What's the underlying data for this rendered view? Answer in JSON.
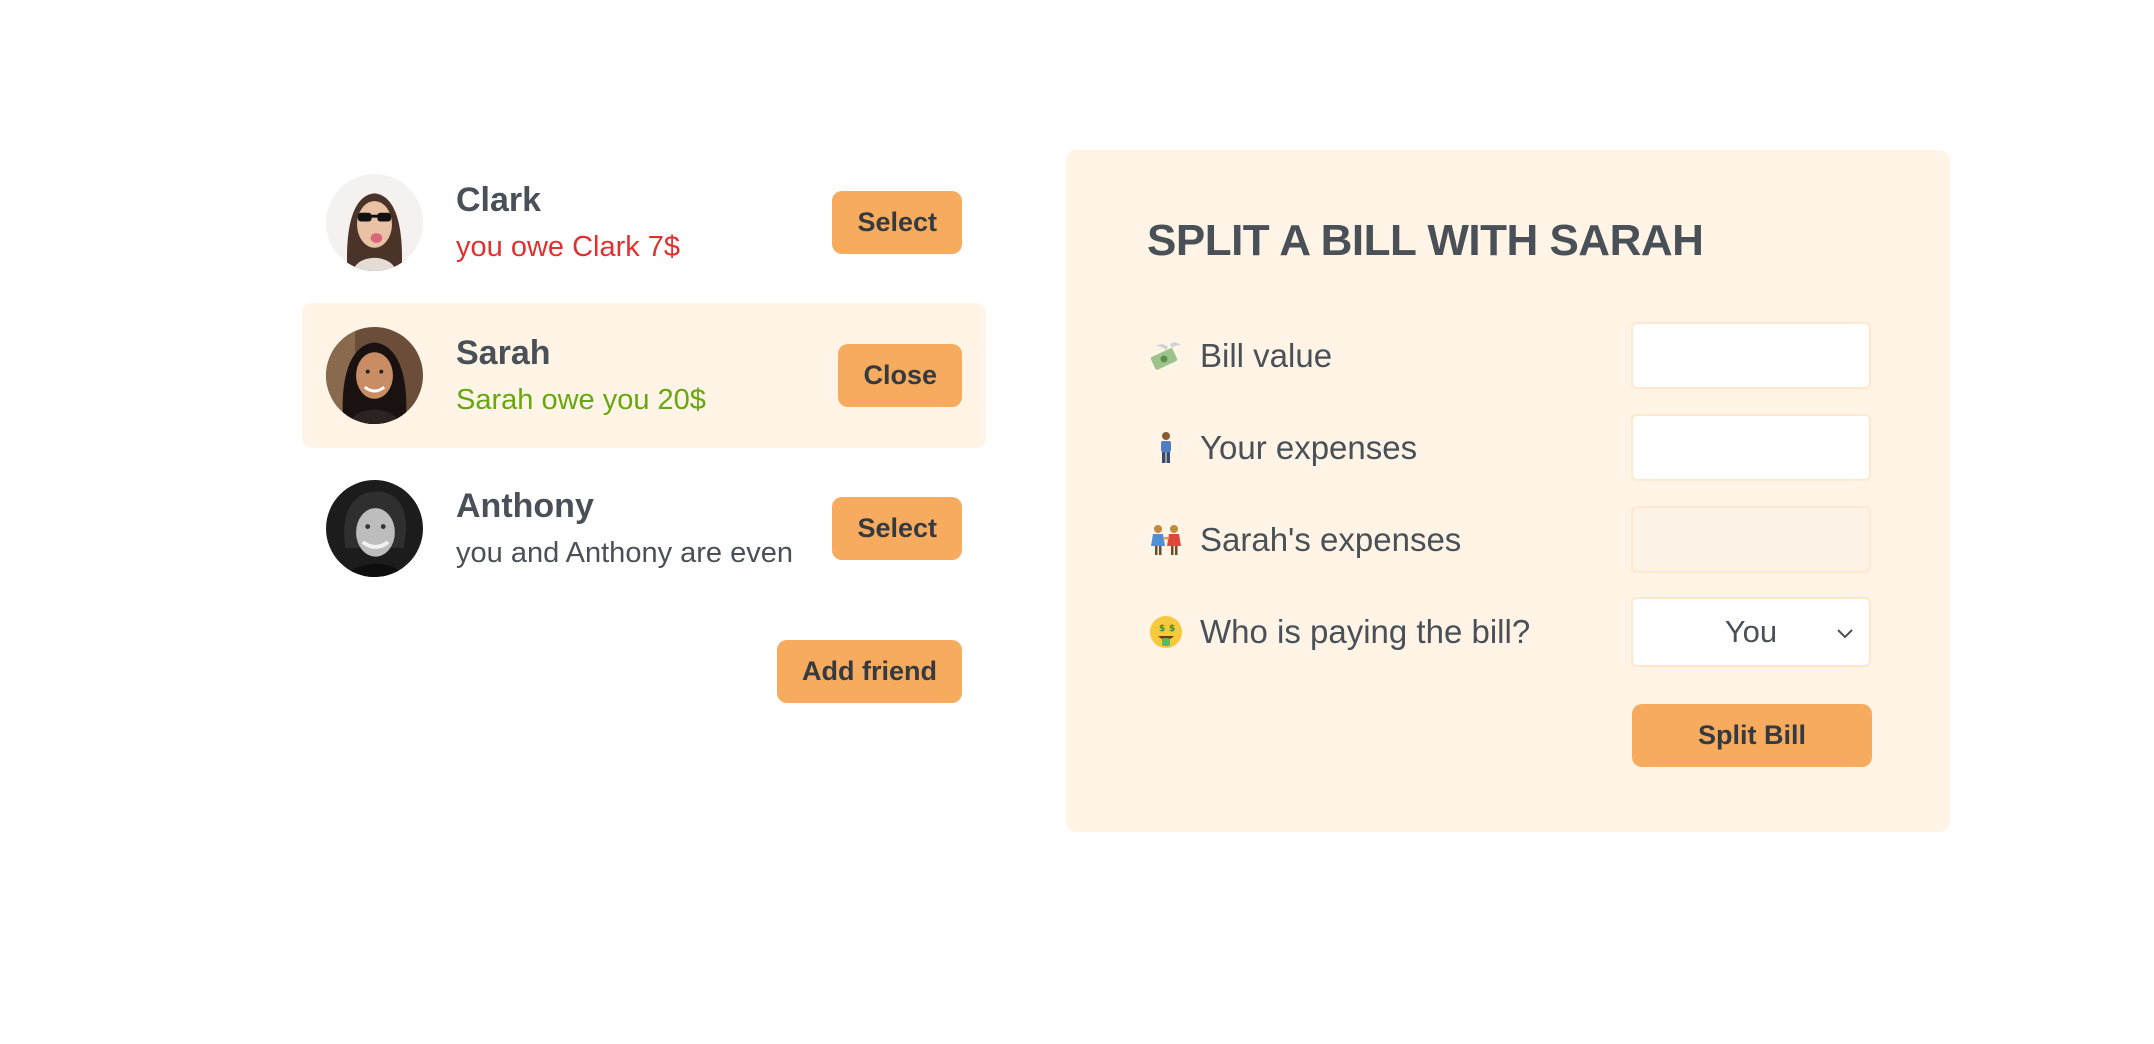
{
  "friends": [
    {
      "name": "Clark",
      "status": "you owe Clark 7$",
      "status_tone": "negative",
      "button": "Select",
      "selected": false,
      "avatar": "clark-avatar"
    },
    {
      "name": "Sarah",
      "status": "Sarah owe you 20$",
      "status_tone": "positive",
      "button": "Close",
      "selected": true,
      "avatar": "sarah-avatar"
    },
    {
      "name": "Anthony",
      "status": "you and Anthony are even",
      "status_tone": "neutral",
      "button": "Select",
      "selected": false,
      "avatar": "anthony-avatar"
    }
  ],
  "add_friend_label": "Add friend",
  "split_form": {
    "title": "Split a bill with Sarah",
    "bill_value": {
      "icon": "money-with-wings-icon",
      "label": "Bill value",
      "value": ""
    },
    "your_expenses": {
      "icon": "standing-person-icon",
      "label": "Your expenses",
      "value": ""
    },
    "friend_expenses": {
      "icon": "two-women-holding-hands-icon",
      "label": "Sarah's expenses",
      "value": ""
    },
    "payer": {
      "icon": "money-mouth-face-icon",
      "label": "Who is paying the bill?",
      "selected": "You"
    },
    "submit_label": "Split Bill"
  },
  "colors": {
    "accent": "#f6ab5e",
    "light_bg": "#fff4e6",
    "text": "#495057",
    "negative": "#e03131",
    "positive": "#66a80f"
  }
}
